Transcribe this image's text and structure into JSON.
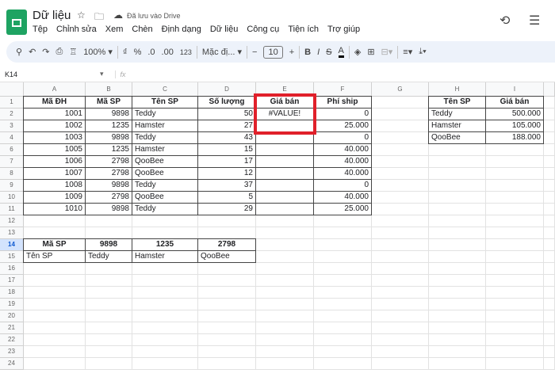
{
  "app": {
    "title": "Dữ liệu",
    "saved_status": "Đã lưu vào Drive",
    "menu": [
      "Tệp",
      "Chỉnh sửa",
      "Xem",
      "Chèn",
      "Định dạng",
      "Dữ liệu",
      "Công cụ",
      "Tiện ích",
      "Trợ giúp"
    ]
  },
  "toolbar": {
    "zoom": "100%",
    "currency": "₫",
    "percent": "%",
    "dec_less": ".0",
    "dec_more": ".00",
    "format_123": "123",
    "font": "Mặc đị...",
    "font_size": "10",
    "bold": "B",
    "italic": "I",
    "strike": "S",
    "text_color": "A"
  },
  "formula_bar": {
    "cell_ref": "K14",
    "fx": "fx",
    "value": ""
  },
  "colors": {
    "accent_box": "#e0202a",
    "selected_header": "#d3e3fd"
  },
  "columns": [
    "A",
    "B",
    "C",
    "D",
    "E",
    "F",
    "G",
    "H",
    "I",
    ""
  ],
  "rows": [
    {
      "label": "1",
      "cells": [
        "Mã ĐH",
        "Mã SP",
        "Tên SP",
        "Số lượng",
        "Giá bán",
        "Phí ship",
        "",
        "Tên SP",
        "Giá bán"
      ]
    },
    {
      "label": "2",
      "cells": [
        "1001",
        "9898",
        "Teddy",
        "50",
        "#VALUE!",
        "0",
        "",
        "Teddy",
        "500.000"
      ]
    },
    {
      "label": "3",
      "cells": [
        "1002",
        "1235",
        "Hamster",
        "27",
        "",
        "25.000",
        "",
        "Hamster",
        "105.000"
      ]
    },
    {
      "label": "4",
      "cells": [
        "1003",
        "9898",
        "Teddy",
        "43",
        "",
        "0",
        "",
        "QooBee",
        "188.000"
      ]
    },
    {
      "label": "6",
      "cells": [
        "1005",
        "1235",
        "Hamster",
        "15",
        "",
        "40.000",
        "",
        "",
        ""
      ]
    },
    {
      "label": "7",
      "cells": [
        "1006",
        "2798",
        "QooBee",
        "17",
        "",
        "40.000",
        "",
        "",
        ""
      ]
    },
    {
      "label": "8",
      "cells": [
        "1007",
        "2798",
        "QooBee",
        "12",
        "",
        "40.000",
        "",
        "",
        ""
      ]
    },
    {
      "label": "9",
      "cells": [
        "1008",
        "9898",
        "Teddy",
        "37",
        "",
        "0",
        "",
        "",
        ""
      ]
    },
    {
      "label": "10",
      "cells": [
        "1009",
        "2798",
        "QooBee",
        "5",
        "",
        "40.000",
        "",
        "",
        ""
      ]
    },
    {
      "label": "11",
      "cells": [
        "1010",
        "9898",
        "Teddy",
        "29",
        "",
        "25.000",
        "",
        "",
        ""
      ]
    },
    {
      "label": "12",
      "cells": [
        "",
        "",
        "",
        "",
        "",
        "",
        "",
        "",
        ""
      ]
    },
    {
      "label": "13",
      "cells": [
        "",
        "",
        "",
        "",
        "",
        "",
        "",
        "",
        ""
      ]
    },
    {
      "label": "14",
      "cells": [
        "Mã SP",
        "9898",
        "1235",
        "2798",
        "",
        "",
        "",
        "",
        ""
      ]
    },
    {
      "label": "15",
      "cells": [
        "Tên SP",
        "Teddy",
        "Hamster",
        "QooBee",
        "",
        "",
        "",
        "",
        ""
      ]
    },
    {
      "label": "16",
      "cells": []
    },
    {
      "label": "17",
      "cells": []
    },
    {
      "label": "18",
      "cells": []
    },
    {
      "label": "19",
      "cells": []
    },
    {
      "label": "20",
      "cells": []
    },
    {
      "label": "21",
      "cells": []
    },
    {
      "label": "22",
      "cells": []
    },
    {
      "label": "23",
      "cells": []
    },
    {
      "label": "24",
      "cells": []
    }
  ]
}
